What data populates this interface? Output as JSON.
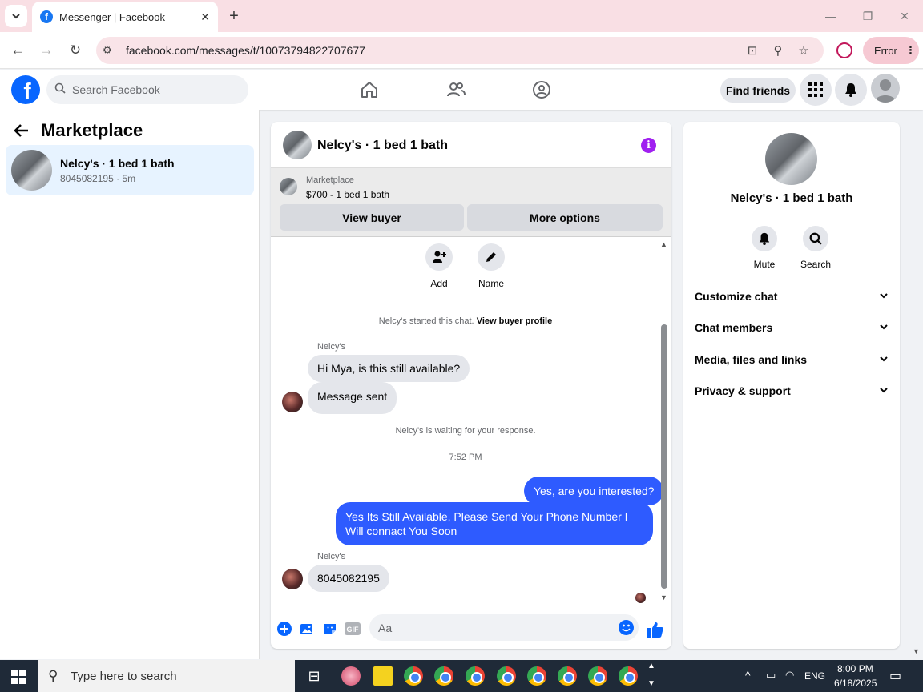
{
  "browser": {
    "tab_title": "Messenger | Facebook",
    "url": "facebook.com/messages/t/10073794822707677",
    "error_label": "Error"
  },
  "fb_header": {
    "search_placeholder": "Search Facebook",
    "find_friends_label": "Find friends"
  },
  "left_panel": {
    "title": "Marketplace",
    "conversation": {
      "title": "Nelcy's · 1 bed 1 bath",
      "subtitle": "8045082195 · 5m"
    }
  },
  "chat": {
    "header_title": "Nelcy's · 1 bed 1 bath",
    "marketplace_label": "Marketplace",
    "listing_price": "$700 - 1 bed 1 bath",
    "view_buyer_label": "View buyer",
    "more_options_label": "More options",
    "add_label": "Add",
    "name_label": "Name",
    "started_text": "Nelcy's started this chat.",
    "view_buyer_profile": "View buyer profile",
    "sender_name_1": "Nelcy's",
    "msg_in_1": "Hi Mya, is this still available?",
    "msg_in_2": "Message sent",
    "waiting_text": "Nelcy's is waiting for your response.",
    "timestamp": "7:52 PM",
    "msg_out_1": "Yes, are you interested?",
    "msg_out_2": "Yes Its Still Available, Please Send Your Phone Number I Will connact You Soon",
    "sender_name_2": "Nelcy's",
    "msg_in_3": "8045082195",
    "composer_placeholder": "Aa"
  },
  "right_panel": {
    "title": "Nelcy's · 1 bed 1 bath",
    "mute_label": "Mute",
    "search_label": "Search",
    "sections": [
      "Customize chat",
      "Chat members",
      "Media, files and links",
      "Privacy & support"
    ]
  },
  "taskbar": {
    "search_placeholder": "Type here to search",
    "language": "ENG",
    "time": "8:00 PM",
    "date": "6/18/2025"
  },
  "colors": {
    "fb_blue": "#0866ff",
    "outgoing_bubble": "#2e5bff",
    "incoming_bubble": "#e4e6eb",
    "info_purple": "#a020f0",
    "tabstrip": "#f9dfe4"
  }
}
